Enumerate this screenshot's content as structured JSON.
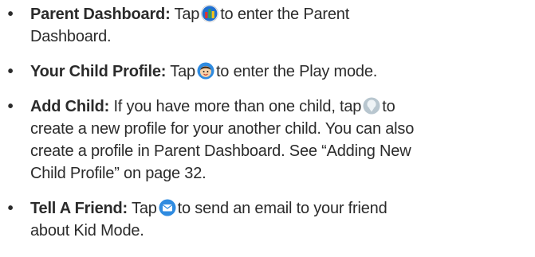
{
  "items": [
    {
      "term": "Parent Dashboard:",
      "before": "Tap",
      "after": "to enter the Parent",
      "line2": "Dashboard.",
      "icon": "parent-dashboard-icon"
    },
    {
      "term": "Your Child Profile:",
      "before": "Tap",
      "after": "to enter the Play mode.",
      "icon": "child-profile-icon"
    },
    {
      "term": "Add Child:",
      "before": "If you have more than one child, tap",
      "after": "to",
      "line2": "create a new profile for your another child. You can also",
      "line3": "create a profile in Parent Dashboard.  See “Adding New",
      "line4": "Child Profile” on page 32.",
      "icon": "add-child-icon"
    },
    {
      "term": "Tell A  Friend:",
      "before": "Tap",
      "after": "to send an email to your friend",
      "line2": "about Kid  Mode.",
      "icon": "email-icon"
    }
  ],
  "bullet_char": "•",
  "colors": {
    "text": "#2b2b2b",
    "dashboard_red": "#e2342b",
    "dashboard_green": "#3aa63f",
    "dashboard_blue": "#1f6fd1",
    "email_blue": "#2f8be0",
    "add_child_gray": "#b8c6cf"
  }
}
